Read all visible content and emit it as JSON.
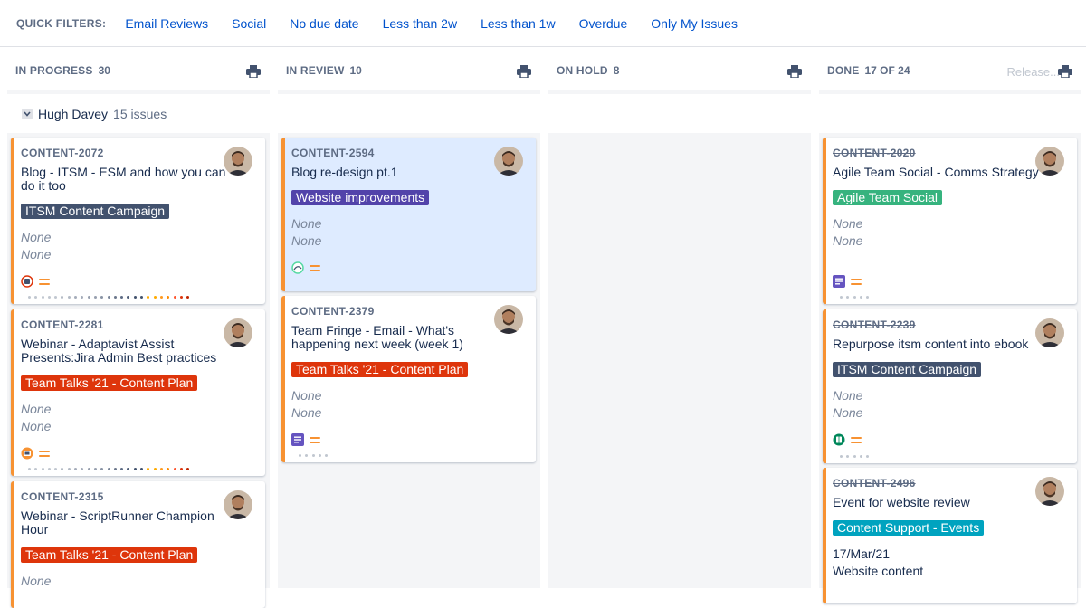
{
  "quick_filters": {
    "label": "QUICK FILTERS:",
    "items": [
      "Email Reviews",
      "Social",
      "No due date",
      "Less than 2w",
      "Less than 1w",
      "Overdue",
      "Only My Issues"
    ]
  },
  "columns": [
    {
      "title": "IN PROGRESS",
      "count": "30"
    },
    {
      "title": "IN REVIEW",
      "count": "10"
    },
    {
      "title": "ON HOLD",
      "count": "8"
    },
    {
      "title": "DONE",
      "count": "17 OF 24",
      "release": "Release..."
    }
  ],
  "swimlane": {
    "name": "Hugh Davey",
    "count": "15 issues"
  },
  "colors": {
    "accent": "#0052cc",
    "flag": "#f79232",
    "selected_card": "#deebff"
  },
  "cards": {
    "c2072": {
      "key": "CONTENT-2072",
      "summary": "Blog - ITSM - ESM and how you can do it too",
      "epic": "ITSM Content Campaign",
      "epic_color": "#42526e",
      "field1": "None",
      "field2": "None",
      "icon": "bug-icon"
    },
    "c2281": {
      "key": "CONTENT-2281",
      "summary": "Webinar - Adaptavist Assist Presents:Jira Admin Best practices",
      "epic": "Team Talks '21 - Content Plan",
      "epic_color": "#de350b",
      "field1": "None",
      "field2": "None",
      "icon": "webinar-icon"
    },
    "c2315": {
      "key": "CONTENT-2315",
      "summary": "Webinar - ScriptRunner Champion Hour",
      "epic": "Team Talks '21 - Content Plan",
      "epic_color": "#de350b",
      "field1": "None"
    },
    "c2594": {
      "key": "CONTENT-2594",
      "summary": "Blog re-design pt.1",
      "epic": "Website improvements",
      "epic_color": "#5243aa",
      "field1": "None",
      "field2": "None",
      "icon": "design-icon"
    },
    "c2379": {
      "key": "CONTENT-2379",
      "summary": "Team Fringe - Email - What's happening next week (week 1)",
      "epic": "Team Talks '21 - Content Plan",
      "epic_color": "#de350b",
      "field1": "None",
      "field2": "None",
      "icon": "document-icon"
    },
    "c2020": {
      "key": "CONTENT-2020",
      "summary": "Agile Team Social - Comms Strategy",
      "epic": "Agile Team Social",
      "epic_color": "#36b37e",
      "field1": "None",
      "field2": "None",
      "icon": "document-icon"
    },
    "c2239": {
      "key": "CONTENT-2239",
      "summary": "Repurpose itsm content into ebook",
      "epic": "ITSM Content Campaign",
      "epic_color": "#42526e",
      "field1": "None",
      "field2": "None",
      "icon": "ebook-icon"
    },
    "c2496": {
      "key": "CONTENT-2496",
      "summary": "Event for website review",
      "epic": "Content Support - Events",
      "epic_color": "#00a3bf",
      "field1": "17/Mar/21",
      "field2": "Website content"
    }
  }
}
